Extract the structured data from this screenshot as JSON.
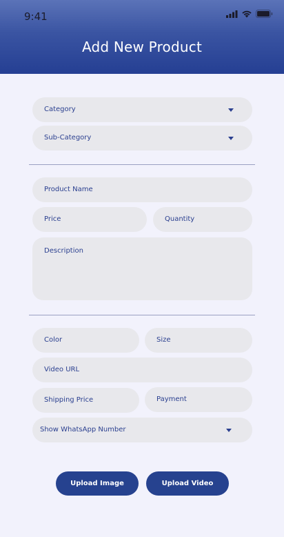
{
  "status_bar": {
    "time": "9:41"
  },
  "header": {
    "title": "Add New Product"
  },
  "form": {
    "category": "Category",
    "sub_category": "Sub-Category",
    "product_name": "Product Name",
    "price": "Price",
    "quantity": "Quantity",
    "description": "Description",
    "color": "Color",
    "size": "Size",
    "video_url": "Video URL",
    "shipping_price": "Shipping Price",
    "payment": "Payment",
    "show_whatsapp": "Show WhatsApp Number"
  },
  "actions": {
    "upload_image": "Upload Image",
    "upload_video": "Upload Video"
  },
  "colors": {
    "header_top": "#5b73b8",
    "header_bottom": "#253f93",
    "background": "#f2f2fc",
    "field_bg": "#e8e8ec",
    "accent": "#26428f"
  },
  "icons": [
    "signal-icon",
    "wifi-icon",
    "battery-icon",
    "dropdown-caret-icon"
  ]
}
